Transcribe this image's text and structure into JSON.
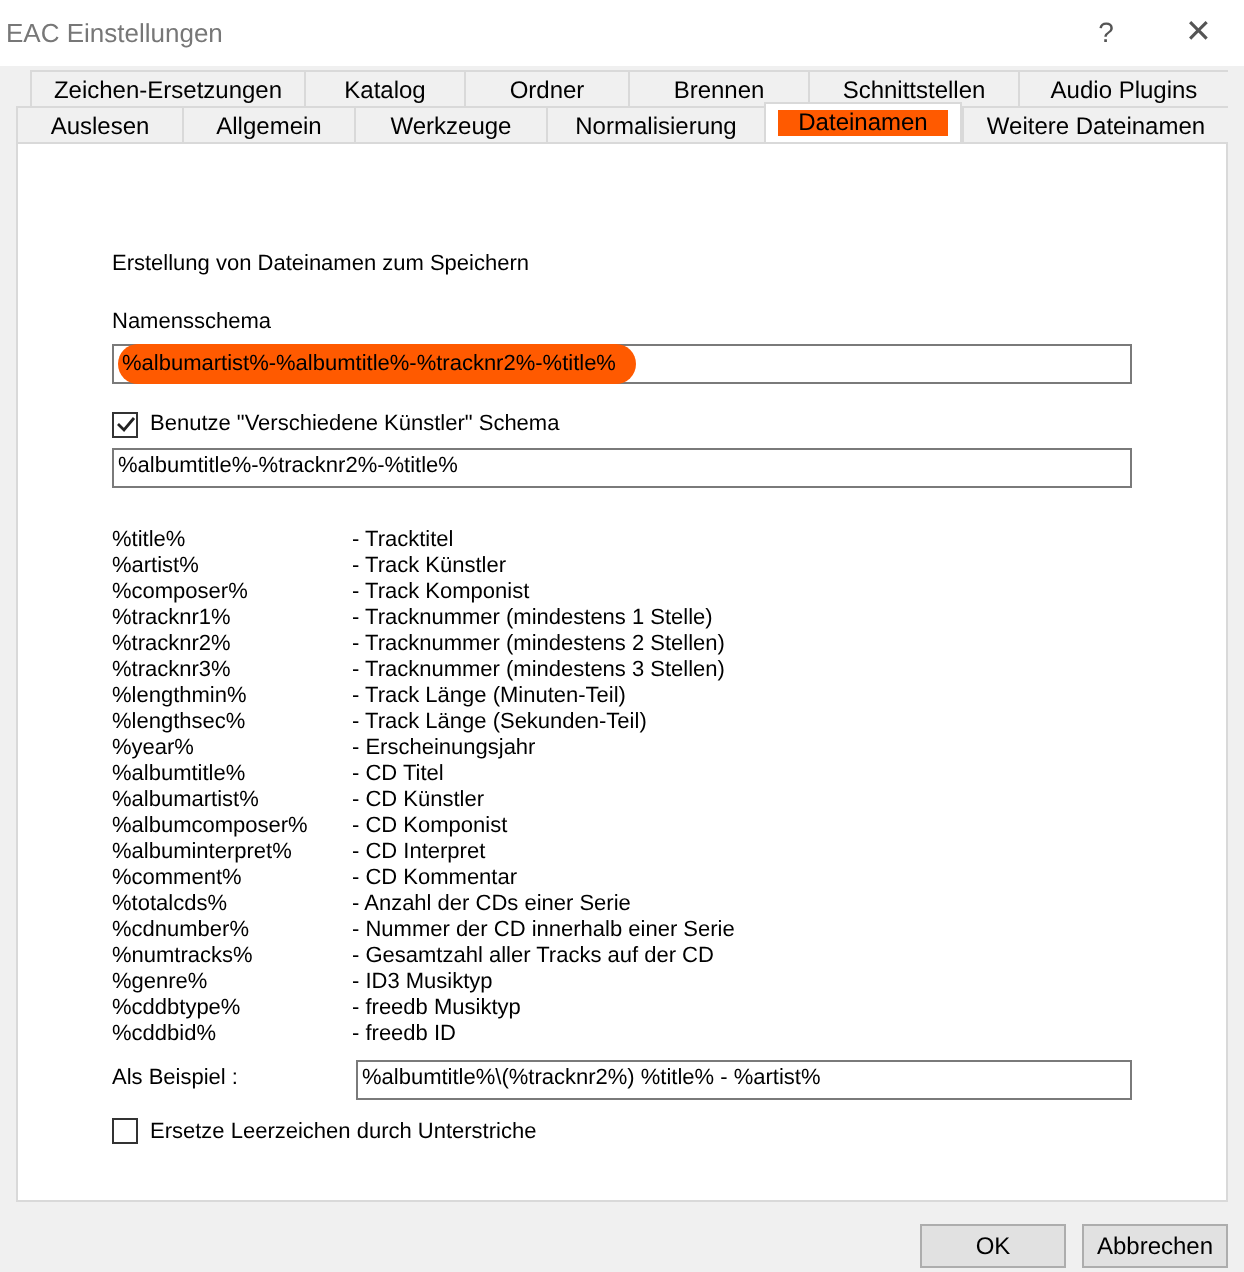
{
  "window": {
    "title": "EAC Einstellungen",
    "help": "?",
    "close": "✕"
  },
  "tab_rows": [
    [
      {
        "label": "Zeichen-Ersetzungen",
        "selected": false
      },
      {
        "label": "Katalog",
        "selected": false
      },
      {
        "label": "Ordner",
        "selected": false
      },
      {
        "label": "Brennen",
        "selected": false
      },
      {
        "label": "Schnittstellen",
        "selected": false
      },
      {
        "label": "Audio Plugins",
        "selected": false
      }
    ],
    [
      {
        "label": "Auslesen",
        "selected": false
      },
      {
        "label": "Allgemein",
        "selected": false
      },
      {
        "label": "Werkzeuge",
        "selected": false
      },
      {
        "label": "Normalisierung",
        "selected": false
      },
      {
        "label": "Dateinamen",
        "selected": true
      },
      {
        "label": "Weitere Dateinamen",
        "selected": false
      }
    ]
  ],
  "heading": "Erstellung von Dateinamen zum Speichern",
  "naming_scheme": {
    "label": "Namensschema",
    "value": "%albumartist%-%albumtitle%-%tracknr2%-%title%",
    "highlighted": true
  },
  "various_artists": {
    "label": "Benutze \"Verschiedene Künstler\" Schema",
    "checked": true,
    "value": "%albumtitle%-%tracknr2%-%title%"
  },
  "variables": [
    {
      "name": "%title%",
      "description": "- Tracktitel"
    },
    {
      "name": "%artist%",
      "description": "- Track Künstler"
    },
    {
      "name": "%composer%",
      "description": "- Track Komponist"
    },
    {
      "name": "%tracknr1%",
      "description": "- Tracknummer (mindestens 1 Stelle)"
    },
    {
      "name": "%tracknr2%",
      "description": "- Tracknummer (mindestens 2 Stellen)"
    },
    {
      "name": "%tracknr3%",
      "description": "- Tracknummer (mindestens 3 Stellen)"
    },
    {
      "name": "%lengthmin%",
      "description": "- Track Länge (Minuten-Teil)"
    },
    {
      "name": "%lengthsec%",
      "description": "- Track Länge (Sekunden-Teil)"
    },
    {
      "name": "%year%",
      "description": "- Erscheinungsjahr"
    },
    {
      "name": "%albumtitle%",
      "description": "- CD Titel"
    },
    {
      "name": "%albumartist%",
      "description": "- CD Künstler"
    },
    {
      "name": "%albumcomposer%",
      "description": "- CD Komponist"
    },
    {
      "name": "%albuminterpret%",
      "description": "- CD Interpret"
    },
    {
      "name": "%comment%",
      "description": "- CD Kommentar"
    },
    {
      "name": "%totalcds%",
      "description": "- Anzahl der CDs einer Serie"
    },
    {
      "name": "%cdnumber%",
      "description": "- Nummer der CD innerhalb einer Serie"
    },
    {
      "name": "%numtracks%",
      "description": "- Gesamtzahl aller Tracks auf der CD"
    },
    {
      "name": "%genre%",
      "description": "- ID3 Musiktyp"
    },
    {
      "name": "%cddbtype%",
      "description": "- freedb Musiktyp"
    },
    {
      "name": "%cddbid%",
      "description": "- freedb ID"
    }
  ],
  "example": {
    "label": "Als Beispiel :",
    "value": "%albumtitle%\\(%tracknr2%) %title% - %artist%"
  },
  "replace_spaces": {
    "label": "Ersetze Leerzeichen durch Unterstriche",
    "checked": false
  },
  "buttons": [
    "OK",
    "Abbrechen"
  ]
}
